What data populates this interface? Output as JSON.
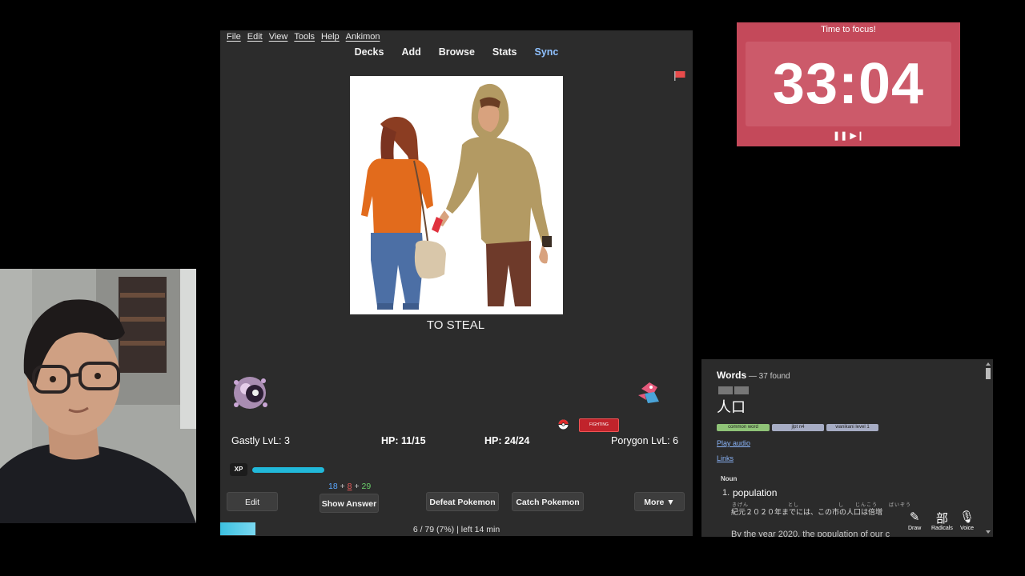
{
  "menu": [
    "File",
    "Edit",
    "View",
    "Tools",
    "Help",
    "Ankimon"
  ],
  "nav": [
    "Decks",
    "Add",
    "Browse",
    "Stats",
    "Sync"
  ],
  "card": {
    "text": "TO STEAL"
  },
  "battle": {
    "type_badge": "FIGHTING",
    "player": "Gastly LvL: 3",
    "player_hp": "HP: 11/15",
    "enemy_hp": "HP: 24/24",
    "enemy": "Porygon LvL: 6",
    "xp_label": "XP",
    "xp_fraction": 0.9
  },
  "counts": {
    "new": "18",
    "learn": "8",
    "review": "29",
    "plus": "+"
  },
  "buttons": {
    "edit": "Edit",
    "show_answer": "Show Answer",
    "defeat": "Defeat Pokemon",
    "catch": "Catch Pokemon",
    "more": "More ▼"
  },
  "progress": {
    "text": "6 / 79 (7%) | left 14 min",
    "fraction": 0.07
  },
  "timer": {
    "title": "Time to focus!",
    "time": "33:04",
    "controls": "❚❚ ▶❙"
  },
  "dictionary": {
    "title": "Words",
    "count": " — 37 found",
    "word": "人口",
    "tags": [
      "common word",
      "jlpt n4",
      "wanikani level 1"
    ],
    "play_audio": "Play audio",
    "links": "Links",
    "pos": "Noun",
    "def_num": "1.",
    "definition": "population",
    "example_furigana": "きげん　　　　　　　とし　　　　　　　し　　じんこう　　ばいぞう",
    "example_jp": "紀元２０２０年までには、この市の人口は倍増",
    "example_en": "By the year 2020, the population of our c",
    "tools": [
      "Draw",
      "Radicals",
      "Voice"
    ]
  },
  "colors": {
    "timer_bg": "#c4495a",
    "xp": "#21b9da",
    "type_badge": "#c1232b",
    "sync": "#8fc1ff"
  }
}
